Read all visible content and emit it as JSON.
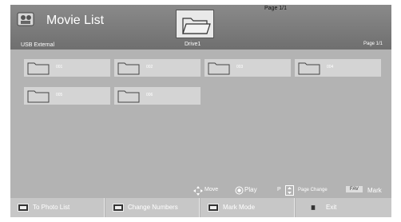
{
  "header": {
    "title": "Movie List",
    "drive_label": "Drive1",
    "page_indicator_top": "Page 1/1",
    "source_label": "USB External",
    "page_indicator_right": "Page 1/1"
  },
  "folders": [
    {
      "label": "001"
    },
    {
      "label": "002"
    },
    {
      "label": "003"
    },
    {
      "label": "004"
    },
    {
      "label": "005"
    },
    {
      "label": "006"
    }
  ],
  "help": {
    "move": "Move",
    "play": "Play",
    "p_key": "P",
    "page_change": "Page Change",
    "fav_key": "FAV",
    "mark": "Mark"
  },
  "footer": {
    "to_photo_list": "To Photo List",
    "change_numbers": "Change Numbers",
    "mark_mode": "Mark Mode",
    "exit": "Exit"
  },
  "colors": {
    "header_bg": "#7c7c7c",
    "screen_bg": "#b3b3b3",
    "tile_bg": "#d4d4d4",
    "footer_btn": "#c7c7c7"
  },
  "icons": {
    "app": "film-camera-icon",
    "drive": "folder-icon",
    "move": "four-way-arrow-icon",
    "play": "radio-button-icon",
    "page": "up-down-arrow-icon",
    "photo": "red-button-icon",
    "numbers": "green-button-icon",
    "mark_mode": "yellow-button-icon",
    "exit": "blue-button-icon"
  }
}
